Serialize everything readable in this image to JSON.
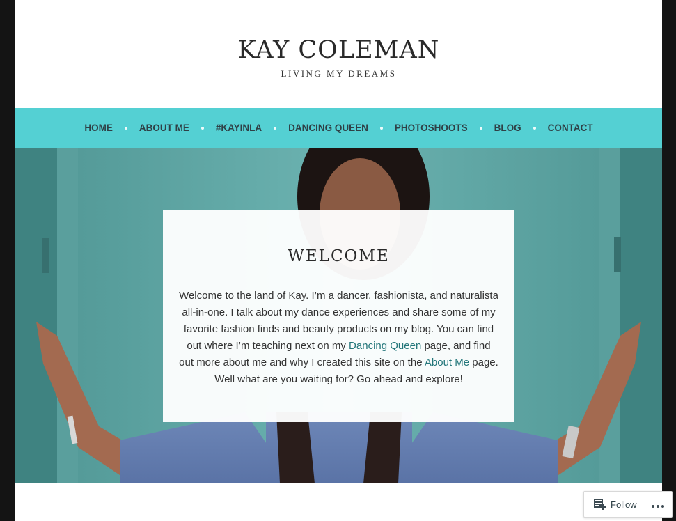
{
  "header": {
    "title": "KAY COLEMAN",
    "tagline": "LIVING MY DREAMS"
  },
  "nav": {
    "items": [
      {
        "label": "HOME"
      },
      {
        "label": "ABOUT ME"
      },
      {
        "label": "#KAYINLA"
      },
      {
        "label": "DANCING QUEEN"
      },
      {
        "label": "PHOTOSHOOTS"
      },
      {
        "label": "BLOG"
      },
      {
        "label": "CONTACT"
      }
    ]
  },
  "welcome": {
    "title": "WELCOME",
    "text_part1": "Welcome to the land of Kay. I’m a dancer, fashionista, and naturalista all-in-one. I talk about my dance experiences and share some of my favorite fashion finds and beauty products on my blog. You can find out where I’m teaching next on my ",
    "link_dancing_queen": "Dancing Queen",
    "text_part2": " page, and find out more about me and why I created this site on the ",
    "link_about_me": "About Me",
    "text_part3": " page. Well what are you waiting for? Go ahead and explore!"
  },
  "follow": {
    "label": "Follow",
    "icon": "reader-follow-icon",
    "more_icon": "ellipsis-icon"
  },
  "colors": {
    "nav_bg": "#54d0d3",
    "link": "#23767a",
    "wall": "#5fa8a6"
  }
}
